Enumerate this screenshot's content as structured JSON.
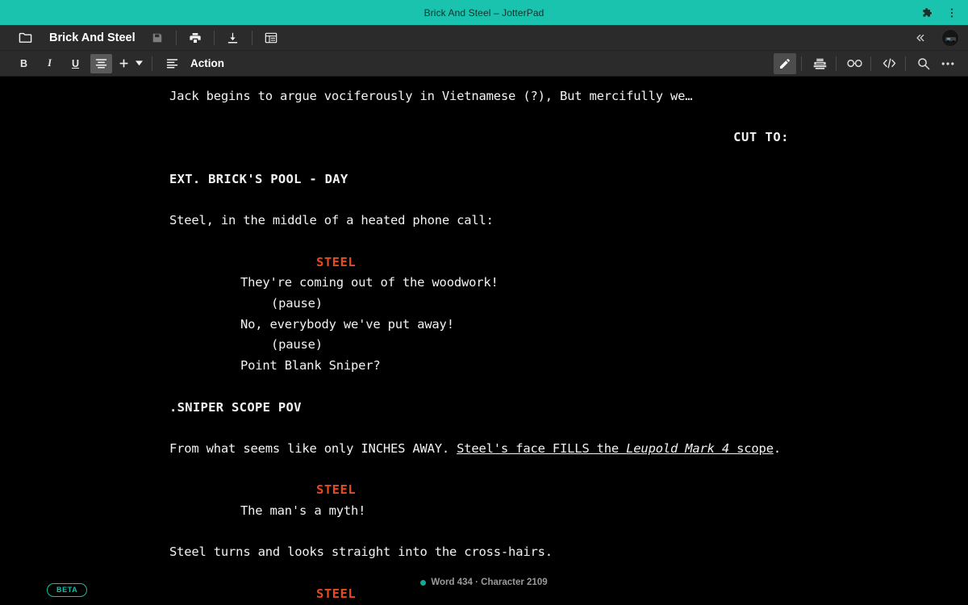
{
  "browser": {
    "window_title": "Brick And Steel – JotterPad",
    "extensions_icon": "puzzle-piece-icon",
    "menu_icon": "three-dot-menu-icon",
    "accent_color": "#19c3ad"
  },
  "app_header": {
    "folder_icon": "folder-icon",
    "document_title": "Brick And Steel",
    "save_icon": "floppy-save-icon",
    "print_icon": "printer-icon",
    "download_icon": "download-icon",
    "outline_icon": "outline-list-icon",
    "collapse_icon": "double-chevron-left-icon",
    "avatar": "user-avatar"
  },
  "format_bar": {
    "bold_label": "B",
    "italic_label": "I",
    "underline_label": "U",
    "align_icon": "align-center-icon",
    "add_icon": "plus-icon",
    "dropdown_icon": "chevron-down-icon",
    "element_icon": "paragraph-style-icon",
    "element_label": "Action",
    "tools": [
      {
        "name": "write-mode",
        "icon": "pencil-icon",
        "active": true
      },
      {
        "name": "typewriter-mode",
        "icon": "typewriter-icon",
        "active": false
      },
      {
        "name": "focus-mode",
        "icon": "glasses-icon",
        "active": false
      },
      {
        "name": "code-view",
        "icon": "code-brackets-icon",
        "active": false
      },
      {
        "name": "search",
        "icon": "magnifier-icon",
        "active": false
      },
      {
        "name": "more-options",
        "icon": "ellipsis-icon",
        "active": false
      }
    ]
  },
  "editor": {
    "character_color": "#e8491d",
    "lines": [
      {
        "type": "action",
        "text": "Jack begins to argue vociferously in Vietnamese (?), But mercifully we…"
      },
      {
        "type": "blank",
        "text": ""
      },
      {
        "type": "transition",
        "text": "CUT TO:"
      },
      {
        "type": "blank",
        "text": ""
      },
      {
        "type": "scene",
        "text": "EXT. BRICK'S POOL - DAY"
      },
      {
        "type": "blank",
        "text": ""
      },
      {
        "type": "action",
        "text": "Steel, in the middle of a heated phone call:"
      },
      {
        "type": "blank",
        "text": ""
      },
      {
        "type": "character",
        "text": "STEEL"
      },
      {
        "type": "dialogue",
        "text": "They're coming out of the woodwork!"
      },
      {
        "type": "paren",
        "text": "(pause)"
      },
      {
        "type": "dialogue",
        "text": "No, everybody we've put away!"
      },
      {
        "type": "paren",
        "text": "(pause)"
      },
      {
        "type": "dialogue",
        "text": "Point Blank Sniper?"
      },
      {
        "type": "blank",
        "text": ""
      },
      {
        "type": "scene",
        "text": ".SNIPER SCOPE POV"
      },
      {
        "type": "blank",
        "text": ""
      },
      {
        "type": "action_rich",
        "prefix": "From what seems like only INCHES AWAY. ",
        "underline_pre": "Steel's face FILLS the ",
        "underline_italic": "Leupold Mark 4",
        "underline_post": " scope",
        "suffix": "."
      },
      {
        "type": "blank",
        "text": ""
      },
      {
        "type": "character",
        "text": "STEEL"
      },
      {
        "type": "dialogue",
        "text": "The man's a myth!"
      },
      {
        "type": "blank",
        "text": ""
      },
      {
        "type": "action",
        "text": "Steel turns and looks straight into the cross-hairs."
      },
      {
        "type": "blank",
        "text": ""
      },
      {
        "type": "character",
        "text": "STEEL"
      }
    ]
  },
  "footer": {
    "beta_label": "BETA",
    "status_text": "Word 434 · Character 2109",
    "status_dot_color": "#17a890"
  }
}
